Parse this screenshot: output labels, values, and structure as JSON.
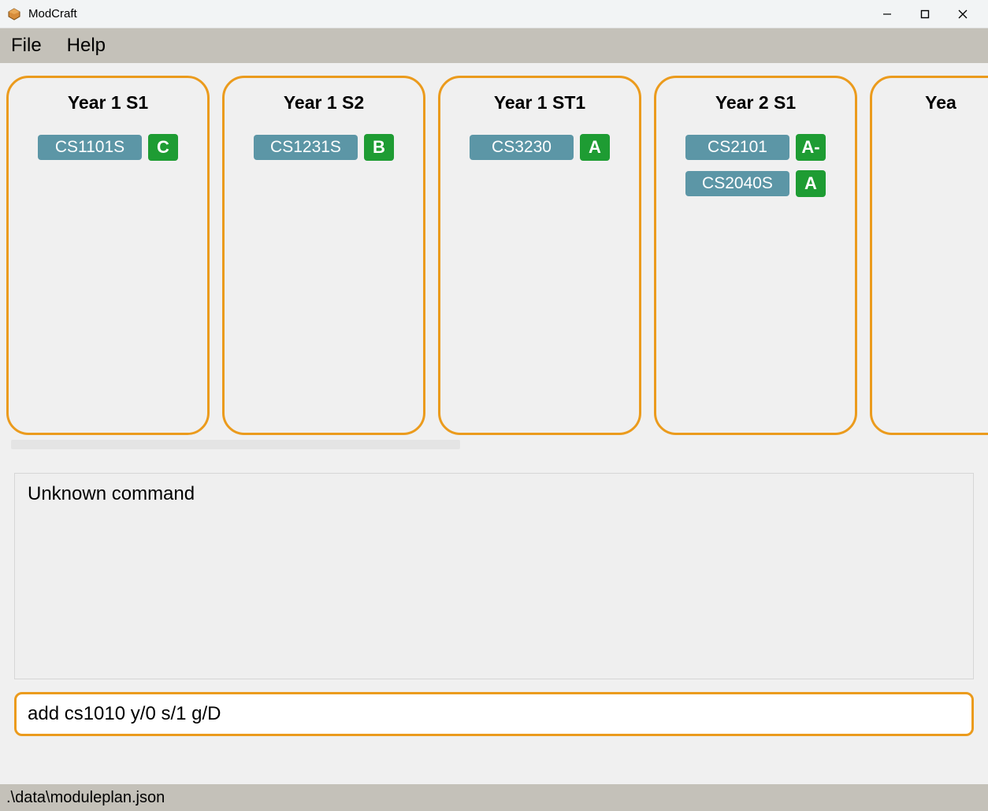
{
  "window": {
    "title": "ModCraft"
  },
  "menu": {
    "file": "File",
    "help": "Help"
  },
  "semesters": [
    {
      "title": "Year 1 S1",
      "modules": [
        {
          "code": "CS1101S",
          "grade": "C"
        }
      ]
    },
    {
      "title": "Year 1 S2",
      "modules": [
        {
          "code": "CS1231S",
          "grade": "B"
        }
      ]
    },
    {
      "title": "Year 1 ST1",
      "modules": [
        {
          "code": "CS3230",
          "grade": "A"
        }
      ]
    },
    {
      "title": "Year 2 S1",
      "modules": [
        {
          "code": "CS2101",
          "grade": "A-"
        },
        {
          "code": "CS2040S",
          "grade": "A"
        }
      ]
    },
    {
      "title": "Yea",
      "modules": []
    }
  ],
  "output": {
    "message": "Unknown command"
  },
  "command": {
    "value": "add cs1010 y/0 s/1 g/D"
  },
  "status": {
    "path": ".\\data\\moduleplan.json"
  }
}
